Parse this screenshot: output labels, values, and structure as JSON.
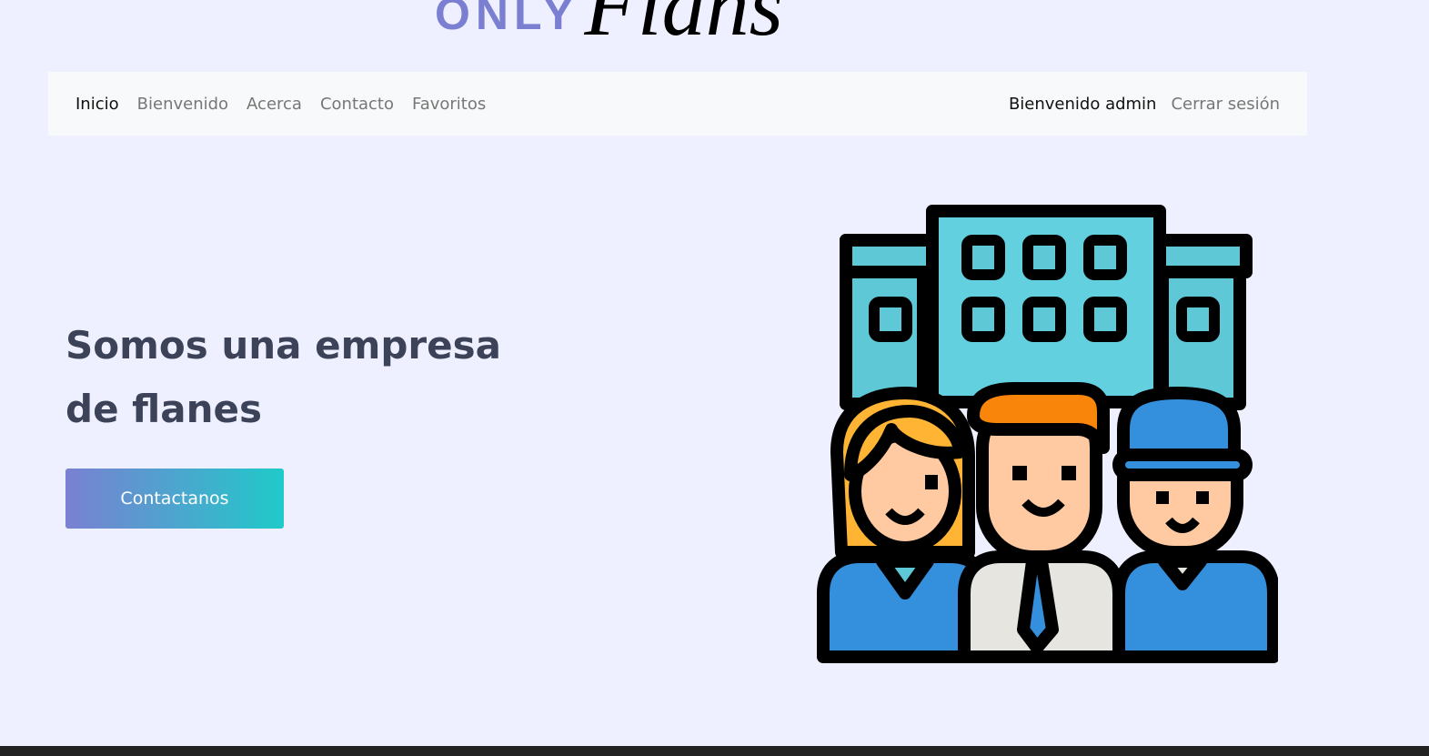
{
  "logo": {
    "word1": "ONLY",
    "word2": "Flans"
  },
  "navbar": {
    "left_items": [
      {
        "label": "Inicio",
        "active": true
      },
      {
        "label": "Bienvenido",
        "active": false
      },
      {
        "label": "Acerca",
        "active": false
      },
      {
        "label": "Contacto",
        "active": false
      },
      {
        "label": "Favoritos",
        "active": false
      }
    ],
    "greeting": "Bienvenido admin",
    "logout": "Cerrar sesión"
  },
  "hero": {
    "title_line1": "Somos una empresa",
    "title_line2": "de flanes",
    "cta_label": "Contactanos"
  },
  "illustration": {
    "icon": "team-building-icon"
  },
  "colors": {
    "background": "#eef0ff",
    "navbar": "#f8f9fa",
    "logo_accent": "#7a7fd1",
    "heading": "#3c4257",
    "cta_gradient_start": "#7a80d2",
    "cta_gradient_end": "#1fcaca"
  }
}
